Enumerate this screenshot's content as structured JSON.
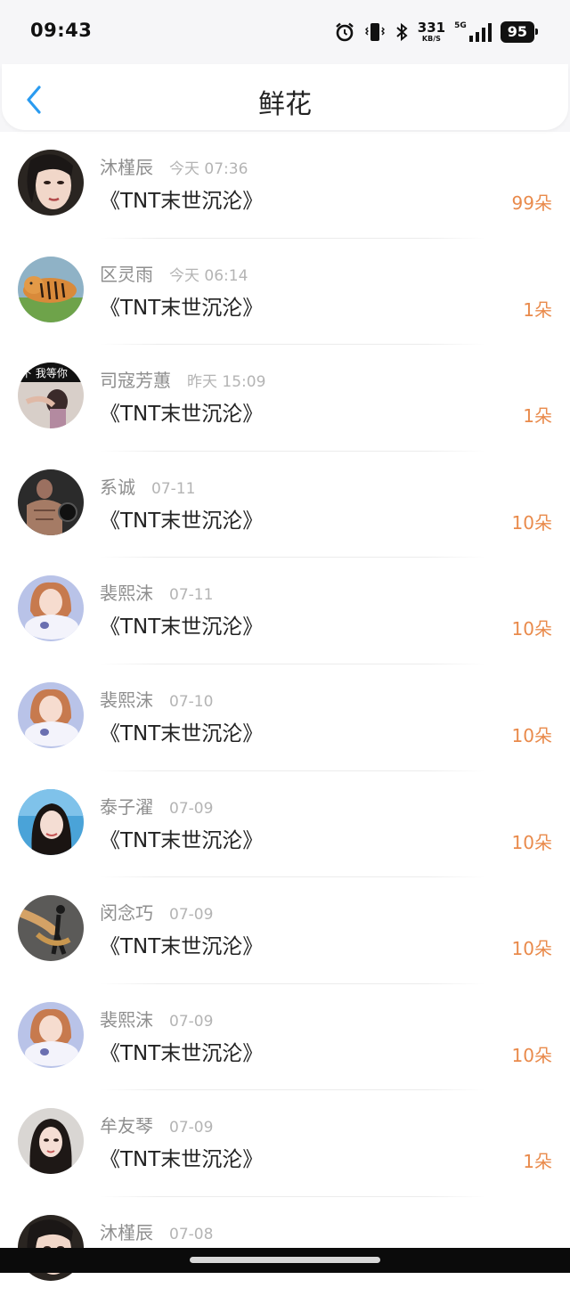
{
  "status_bar": {
    "time": "09:43",
    "net_speed": "331",
    "net_unit": "KB/S",
    "network_type": "5G",
    "battery": "95",
    "icons": [
      "alarm-icon",
      "vibrate-icon",
      "bluetooth-icon",
      "network-speed",
      "signal-icon",
      "battery-icon"
    ]
  },
  "header": {
    "back_icon": "chevron-left-icon",
    "title": "鲜花"
  },
  "colors": {
    "accent_back": "#2a9bf0",
    "amount": "#e98a4b",
    "name": "#8e8e8e",
    "time": "#b4b4b4"
  },
  "items": [
    {
      "name": "沐槿辰",
      "time": "今天 07:36",
      "book": "《TNT末世沉沦》",
      "amount": "99朵",
      "avatar": "portrait-woman"
    },
    {
      "name": "区灵雨",
      "time": "今天 06:14",
      "book": "《TNT末世沉沦》",
      "amount": "1朵",
      "avatar": "tiger"
    },
    {
      "name": "司寇芳蕙",
      "time": "昨天 15:09",
      "book": "《TNT末世沉沦》",
      "amount": "1朵",
      "avatar": "text-photo",
      "avatar_text": "下 我等你"
    },
    {
      "name": "系诚",
      "time": "07-11",
      "book": "《TNT末世沉沦》",
      "amount": "10朵",
      "avatar": "muscle-man"
    },
    {
      "name": "裴熙沫",
      "time": "07-11",
      "book": "《TNT末世沉沦》",
      "amount": "10朵",
      "avatar": "girl-plush"
    },
    {
      "name": "裴熙沫",
      "time": "07-10",
      "book": "《TNT末世沉沦》",
      "amount": "10朵",
      "avatar": "girl-plush"
    },
    {
      "name": "泰子濯",
      "time": "07-09",
      "book": "《TNT末世沉沦》",
      "amount": "10朵",
      "avatar": "girl-sky"
    },
    {
      "name": "闵念巧",
      "time": "07-09",
      "book": "《TNT末世沉沦》",
      "amount": "10朵",
      "avatar": "kick-figure"
    },
    {
      "name": "裴熙沫",
      "time": "07-09",
      "book": "《TNT末世沉沦》",
      "amount": "10朵",
      "avatar": "girl-plush"
    },
    {
      "name": "牟友琴",
      "time": "07-09",
      "book": "《TNT末世沉沦》",
      "amount": "1朵",
      "avatar": "portrait-woman-2"
    },
    {
      "name": "沐槿辰",
      "time": "07-08",
      "book": "",
      "amount": "",
      "avatar": "portrait-woman"
    }
  ]
}
